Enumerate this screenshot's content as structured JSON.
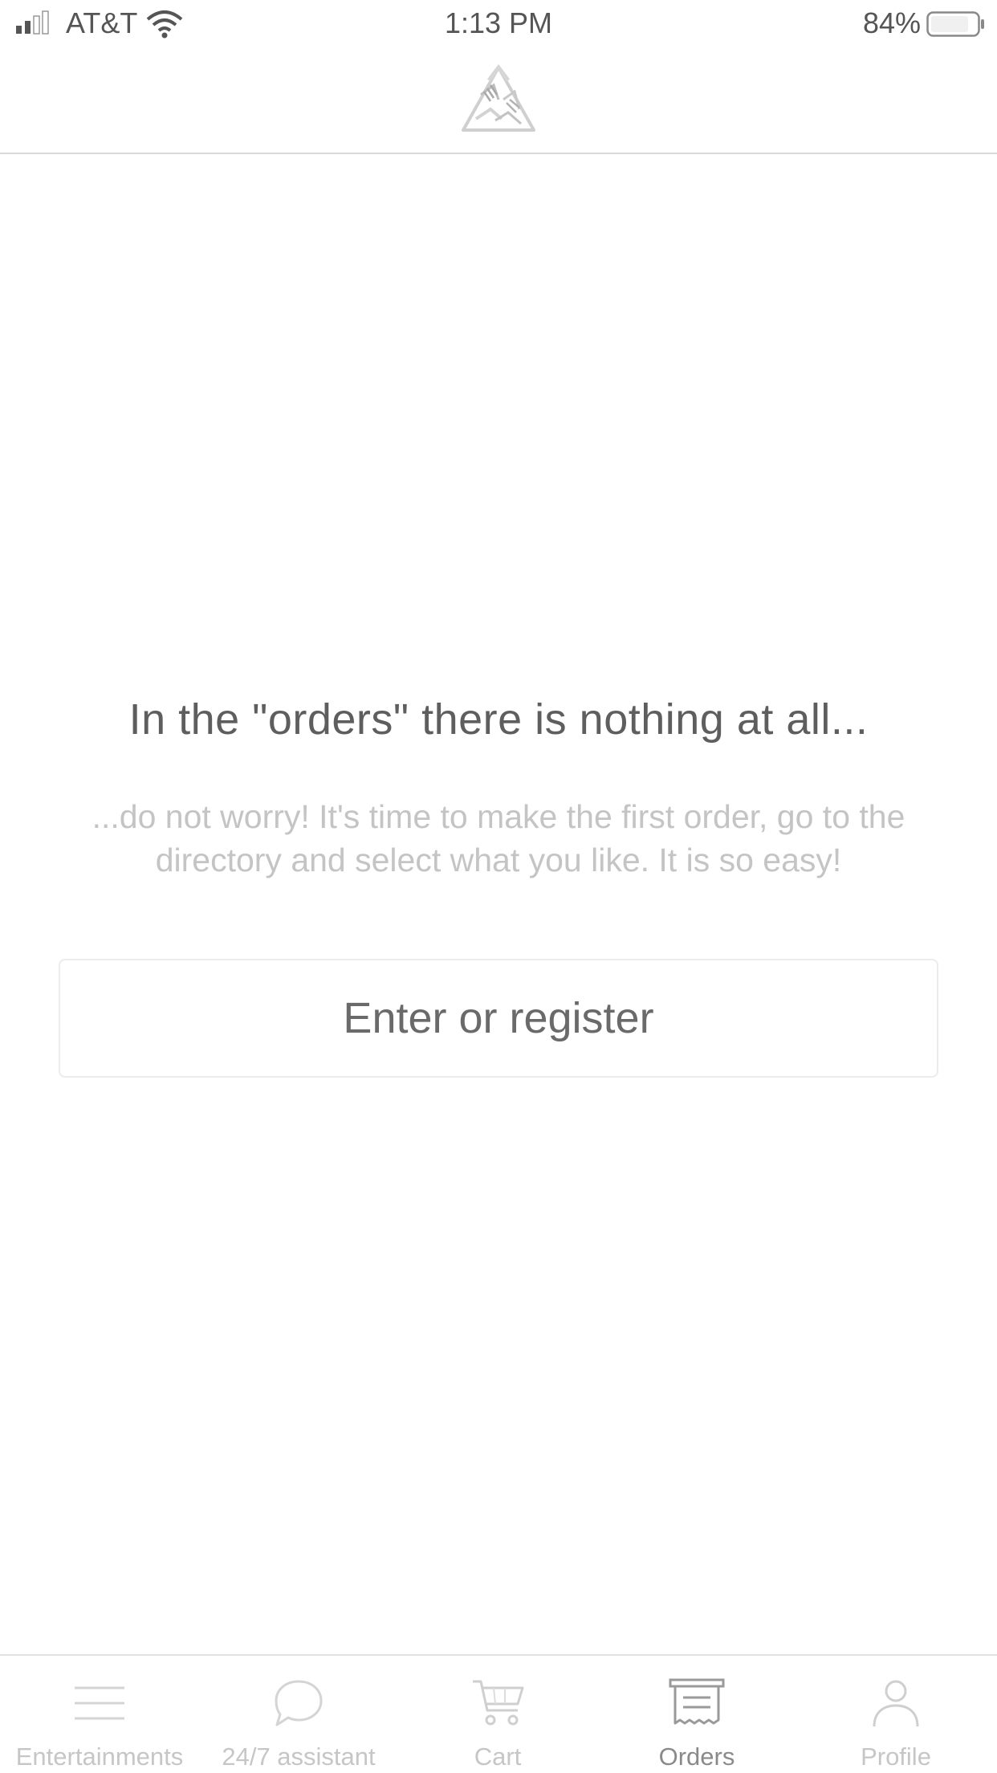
{
  "status": {
    "carrier": "AT&T",
    "time": "1:13 PM",
    "battery": "84%",
    "battery_level": 0.84
  },
  "header": {
    "logo_icon": "hands-triangle-logo-icon"
  },
  "empty_state": {
    "title": "In the \"orders\" there is nothing at all...",
    "subtitle": "...do not worry! It's time to make the first order, go to the directory and select what you like. It is so easy!"
  },
  "login_button": {
    "label": "Enter or register"
  },
  "tabs": [
    {
      "label": "Entertainments",
      "icon": "menu-icon",
      "active": false
    },
    {
      "label": "24/7 assistant",
      "icon": "chat-bubble-icon",
      "active": false
    },
    {
      "label": "Cart",
      "icon": "cart-icon",
      "active": false
    },
    {
      "label": "Orders",
      "icon": "receipt-icon",
      "active": true
    },
    {
      "label": "Profile",
      "icon": "person-icon",
      "active": false
    }
  ],
  "colors": {
    "text_primary": "#5e5e5e",
    "text_secondary": "#c4c4c4",
    "tab_inactive": "#c6c6c6",
    "tab_active": "#8a8a8a",
    "divider": "#d9d9d9"
  }
}
